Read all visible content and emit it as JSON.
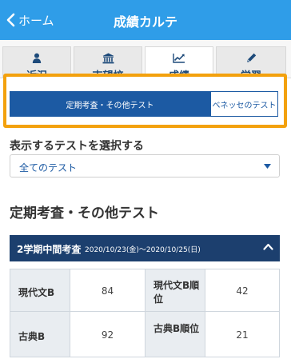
{
  "header": {
    "back_label": "ホーム",
    "title": "成績カルテ"
  },
  "tabs": [
    {
      "label": "近況",
      "icon": "person-icon"
    },
    {
      "label": "志望校",
      "icon": "school-building-icon"
    },
    {
      "label": "成績",
      "icon": "line-chart-icon",
      "active": true
    },
    {
      "label": "学習",
      "icon": "pencil-icon"
    }
  ],
  "segment": {
    "left": "定期考査・その他テスト",
    "right": "ベネッセのテスト"
  },
  "select": {
    "title": "表示するテストを選択する",
    "value": "全てのテスト"
  },
  "section_title": "定期考査・その他テスト",
  "exam": {
    "name": "2学期中間考査",
    "dates": "2020/10/23(金)〜2020/10/25(日)"
  },
  "scores": [
    {
      "subject": "現代文B",
      "score": "84",
      "rank_label": "現代文B順位",
      "rank": "42"
    },
    {
      "subject": "古典B",
      "score": "92",
      "rank_label": "古典B順位",
      "rank": "21"
    }
  ],
  "colors": {
    "header": "#2f9de8",
    "accent_dark": "#1c3f6e",
    "segment_active": "#1c5aa3",
    "highlight": "#f3a10d"
  }
}
